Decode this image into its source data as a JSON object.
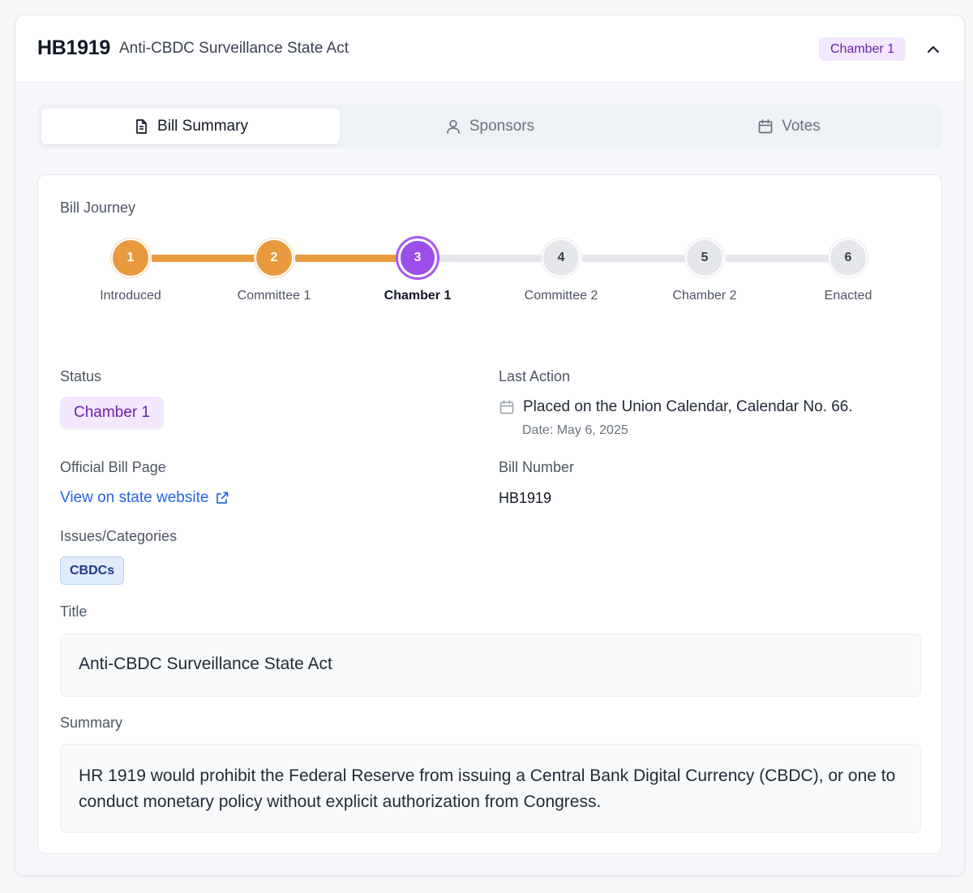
{
  "header": {
    "bill_code": "HB1919",
    "bill_name": "Anti-CBDC Surveillance State Act",
    "stage_badge": "Chamber 1",
    "collapse_icon": "chevron-up-icon"
  },
  "tabs": [
    {
      "label": "Bill Summary",
      "icon": "document-icon",
      "active": true
    },
    {
      "label": "Sponsors",
      "icon": "user-icon",
      "active": false
    },
    {
      "label": "Votes",
      "icon": "calendar-icon",
      "active": false
    }
  ],
  "journey": {
    "label": "Bill Journey",
    "steps": [
      {
        "number": "1",
        "label": "Introduced",
        "state": "done"
      },
      {
        "number": "2",
        "label": "Committee 1",
        "state": "done"
      },
      {
        "number": "3",
        "label": "Chamber 1",
        "state": "current"
      },
      {
        "number": "4",
        "label": "Committee 2",
        "state": "pending"
      },
      {
        "number": "5",
        "label": "Chamber 2",
        "state": "pending"
      },
      {
        "number": "6",
        "label": "Enacted",
        "state": "pending"
      }
    ]
  },
  "details": {
    "status_label": "Status",
    "status_value": "Chamber 1",
    "last_action_label": "Last Action",
    "last_action_text": "Placed on the Union Calendar, Calendar No. 66.",
    "last_action_date": "Date: May 6, 2025",
    "official_page_label": "Official Bill Page",
    "official_page_link": "View on state website",
    "bill_number_label": "Bill Number",
    "bill_number_value": "HB1919",
    "categories_label": "Issues/Categories",
    "categories": [
      "CBDCs"
    ],
    "title_label": "Title",
    "title_value": "Anti-CBDC Surveillance State Act",
    "summary_label": "Summary",
    "summary_value": "HR 1919 would prohibit the Federal Reserve from issuing a Central Bank Digital Currency (CBDC), or one to conduct monetary policy without explicit authorization from Congress."
  },
  "colors": {
    "done": "#e99a3e",
    "current": "#9b4dea",
    "pending": "#e5e7eb",
    "link": "#2563eb",
    "badge_bg": "#f3e8ff",
    "badge_text": "#6b21a8"
  }
}
